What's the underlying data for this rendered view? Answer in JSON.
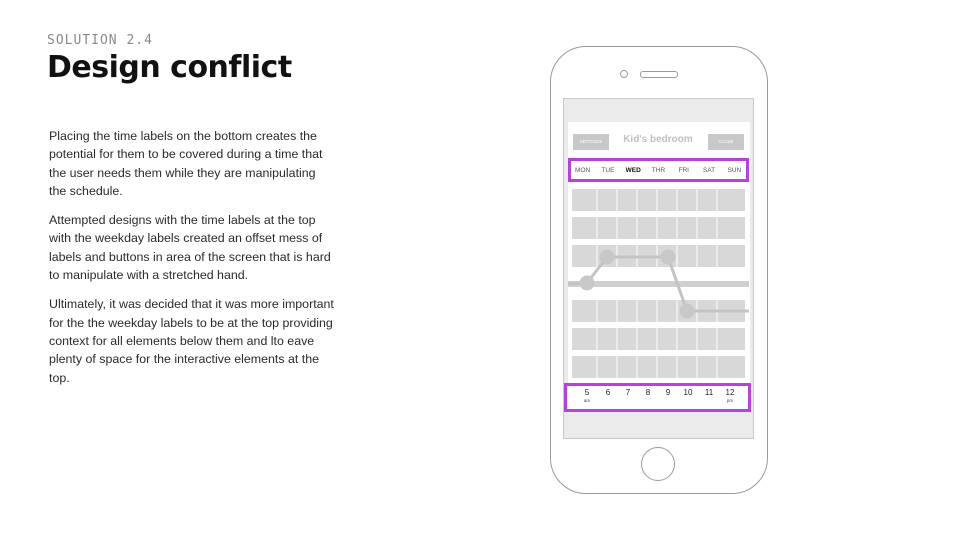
{
  "header": {
    "eyebrow": "SOLUTION 2.4",
    "title": "Design conflict"
  },
  "body": {
    "paragraphs": [
      "Placing the time labels on the bottom creates the potential for them to be covered during a time that the user needs them while they are manipulating the schedule.",
      "Attempted designs with the time labels at the top with the weekday labels created an offset mess of labels and buttons in area of the screen that is hard to manipulate with a stretched hand.",
      "Ultimately, it was decided that it was more important for the the weekday labels to be at the top providing context for all elements below them and lto eave plenty of space for the interactive elements at the top."
    ]
  },
  "app": {
    "settings_label": "SETTINGS",
    "title": "Kid's bedroom",
    "close_label": "CLOSE",
    "days": [
      "MON",
      "TUE",
      "WED",
      "THR",
      "FRI",
      "SAT",
      "SUN"
    ],
    "active_day": "WED",
    "times": [
      {
        "num": "5",
        "sub": "am"
      },
      {
        "num": "6",
        "sub": ""
      },
      {
        "num": "7",
        "sub": ""
      },
      {
        "num": "8",
        "sub": ""
      },
      {
        "num": "9",
        "sub": ""
      },
      {
        "num": "10",
        "sub": ""
      },
      {
        "num": "11",
        "sub": ""
      },
      {
        "num": "12",
        "sub": "pm"
      }
    ]
  },
  "colors": {
    "highlight": "#b542d9",
    "lane": "#d8d8d8",
    "schedule_line": "#c4c4c4"
  }
}
